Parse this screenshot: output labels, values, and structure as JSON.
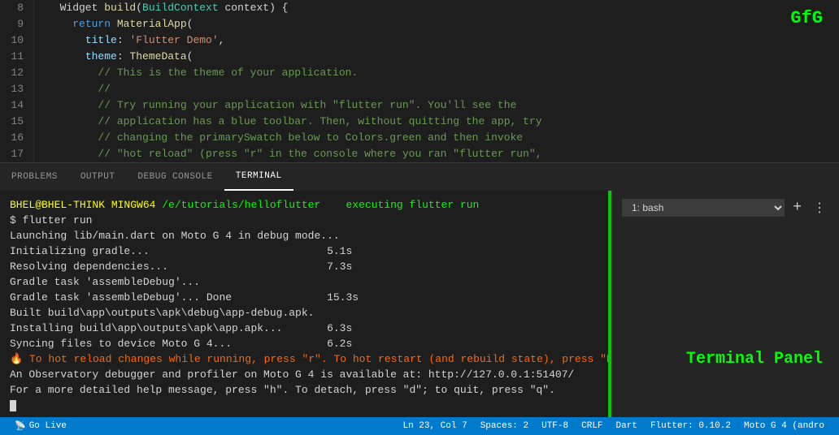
{
  "gfg_label": "GfG",
  "terminal_panel_label": "Terminal Panel",
  "editor": {
    "lines": [
      {
        "num": "8",
        "tokens": [
          {
            "t": "plain",
            "v": "  Widget "
          },
          {
            "t": "fn",
            "v": "build"
          },
          {
            "t": "plain",
            "v": "("
          },
          {
            "t": "type",
            "v": "BuildContext"
          },
          {
            "t": "plain",
            "v": " context) {"
          }
        ]
      },
      {
        "num": "9",
        "tokens": [
          {
            "t": "plain",
            "v": "    "
          },
          {
            "t": "kw",
            "v": "return"
          },
          {
            "t": "plain",
            "v": " "
          },
          {
            "t": "fn",
            "v": "MaterialApp"
          },
          {
            "t": "plain",
            "v": "("
          }
        ]
      },
      {
        "num": "10",
        "tokens": [
          {
            "t": "plain",
            "v": "      "
          },
          {
            "t": "prop",
            "v": "title"
          },
          {
            "t": "plain",
            "v": ": "
          },
          {
            "t": "str",
            "v": "'Flutter Demo'"
          },
          {
            "t": "plain",
            "v": ","
          }
        ]
      },
      {
        "num": "11",
        "tokens": [
          {
            "t": "plain",
            "v": "      "
          },
          {
            "t": "prop",
            "v": "theme"
          },
          {
            "t": "plain",
            "v": ": "
          },
          {
            "t": "fn",
            "v": "ThemeData"
          },
          {
            "t": "plain",
            "v": "("
          }
        ]
      },
      {
        "num": "12",
        "tokens": [
          {
            "t": "comment",
            "v": "        // This is the theme of your application."
          }
        ]
      },
      {
        "num": "13",
        "tokens": [
          {
            "t": "comment",
            "v": "        //"
          }
        ]
      },
      {
        "num": "14",
        "tokens": [
          {
            "t": "comment",
            "v": "        // Try running your application with \"flutter run\". You'll see the"
          }
        ]
      },
      {
        "num": "15",
        "tokens": [
          {
            "t": "comment",
            "v": "        // application has a blue toolbar. Then, without quitting the app, try"
          }
        ]
      },
      {
        "num": "16",
        "tokens": [
          {
            "t": "comment",
            "v": "        // changing the primarySwatch below to Colors.green and then invoke"
          }
        ]
      },
      {
        "num": "17",
        "tokens": [
          {
            "t": "comment",
            "v": "        // \"hot reload\" (press \"r\" in the console where you ran \"flutter run\","
          }
        ]
      }
    ]
  },
  "panel_tabs": [
    {
      "id": "problems",
      "label": "PROBLEMS",
      "active": false
    },
    {
      "id": "output",
      "label": "OUTPUT",
      "active": false
    },
    {
      "id": "debug_console",
      "label": "DEBUG CONSOLE",
      "active": false
    },
    {
      "id": "terminal",
      "label": "TERMINAL",
      "active": true
    }
  ],
  "terminal": {
    "bash_label": "1: bash",
    "lines": [
      {
        "type": "prompt",
        "parts": [
          {
            "cls": "t-prompt-user",
            "v": "BHEL@BHEL-THINK MINGW64"
          },
          {
            "cls": "t-prompt-path",
            "v": " /e/tutorials/helloflutter"
          },
          {
            "cls": "t-plain",
            "v": "    "
          },
          {
            "cls": "t-executing",
            "v": "executing flutter run"
          }
        ]
      },
      {
        "type": "plain",
        "content": "$ flutter run"
      },
      {
        "type": "plain",
        "content": "Launching lib/main.dart on Moto G 4 in debug mode..."
      },
      {
        "type": "timed",
        "text": "Initializing gradle...",
        "time": "5.1s"
      },
      {
        "type": "timed",
        "text": "Resolving dependencies...",
        "time": "7.3s"
      },
      {
        "type": "plain",
        "content": "Gradle task 'assembleDebug'..."
      },
      {
        "type": "timed",
        "text": "Gradle task 'assembleDebug'... Done",
        "time": "15.3s"
      },
      {
        "type": "plain",
        "content": "Built build\\app\\outputs\\apk\\debug\\app-debug.apk."
      },
      {
        "type": "timed",
        "text": "Installing build\\app\\outputs\\apk\\app.apk...",
        "time": "6.3s"
      },
      {
        "type": "timed",
        "text": "Syncing files to device Moto G 4...",
        "time": "6.2s"
      },
      {
        "type": "empty"
      },
      {
        "type": "warning",
        "content": "🔥 To hot reload changes while running, press \"r\". To hot restart (and rebuild state), press \"R\"."
      },
      {
        "type": "plain",
        "content": "An Observatory debugger and profiler on Moto G 4 is available at: http://127.0.0.1:51407/"
      },
      {
        "type": "plain",
        "content": "For a more detailed help message, press \"h\". To detach, press \"d\"; to quit, press \"q\"."
      }
    ]
  },
  "status_bar": {
    "go_live": "$(radio-tower) Go Live",
    "go_live_icon": "📡",
    "ln_col": "Ln 23, Col 7",
    "spaces": "Spaces: 2",
    "encoding": "UTF-8",
    "line_ending": "CRLF",
    "language": "Dart",
    "flutter_version": "Flutter: 0.10.2",
    "device": "Moto G 4 (andro"
  }
}
